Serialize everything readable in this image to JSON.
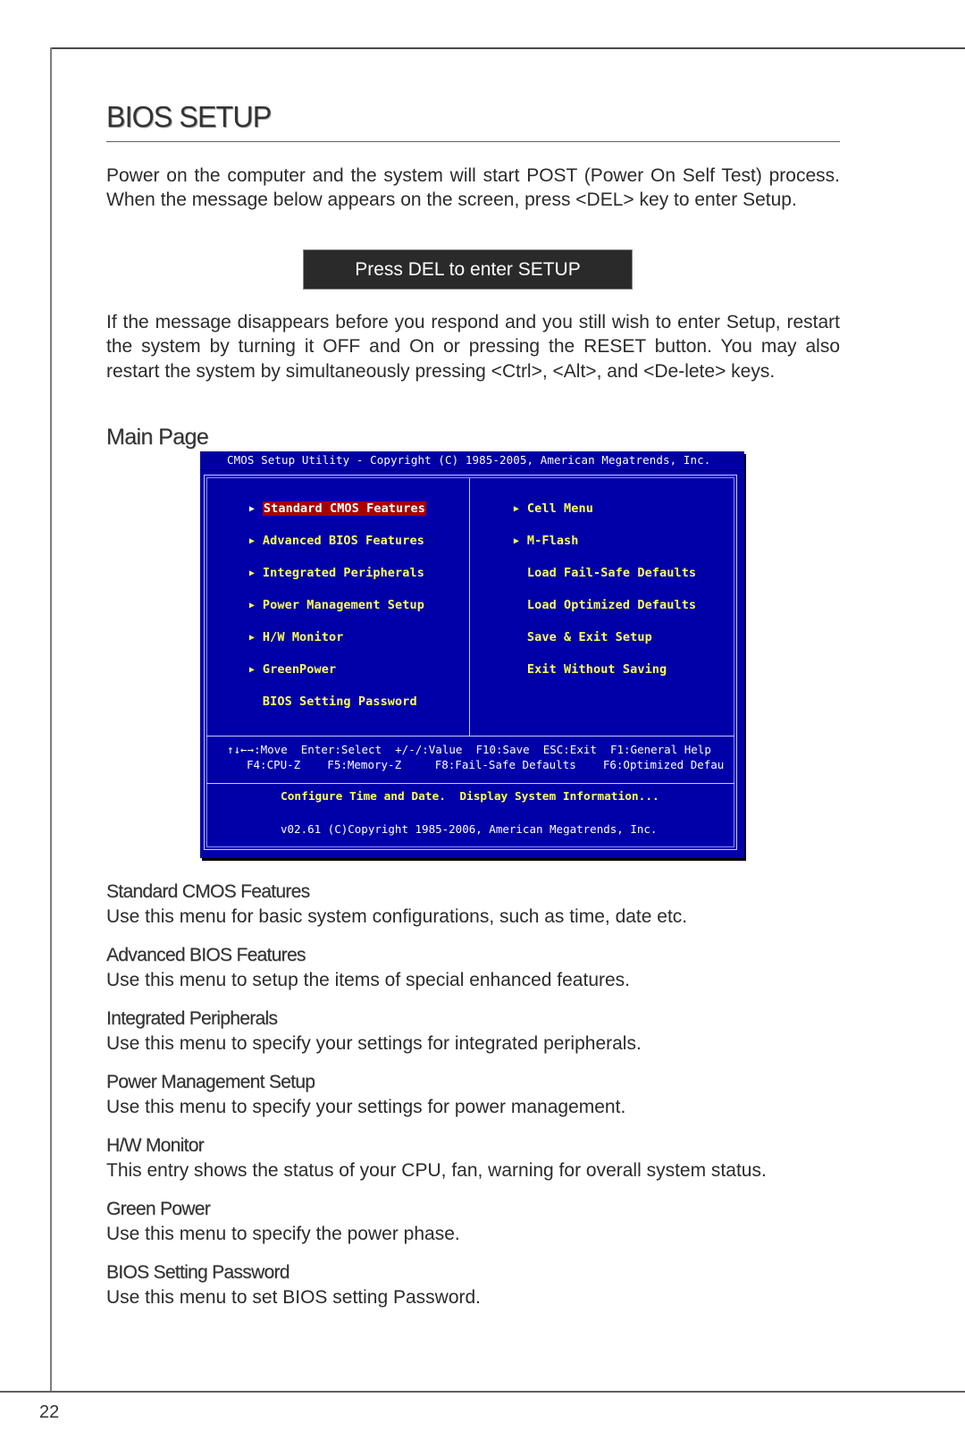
{
  "page": {
    "title": "BIOS SETUP",
    "page_number": "22"
  },
  "intro": {
    "paragraph1": "Power on the computer and the system will start POST (Power On Self Test) process. When the message below appears on the screen, press <DEL> key to enter Setup.",
    "del_message": "Press DEL to enter SETUP",
    "paragraph2": "If the message disappears before you respond and you still wish to enter Setup, restart the system by turning it OFF and On or pressing the RESET button. You may also restart the system by simultaneously pressing <Ctrl>, <Alt>, and <De-lete> keys."
  },
  "main_page": {
    "heading": "Main Page"
  },
  "bios_screen": {
    "colors": {
      "background": "#0000a8",
      "item_text": "#ffff55",
      "highlight": "#a80000",
      "help_text": "#ffffff"
    },
    "title_bar": "CMOS Setup Utility - Copyright (C) 1985-2005, American Megatrends, Inc.",
    "left_menu": [
      {
        "label": "Standard CMOS Features",
        "submenu": true,
        "selected": true
      },
      {
        "label": "Advanced BIOS Features",
        "submenu": true,
        "selected": false
      },
      {
        "label": "Integrated Peripherals",
        "submenu": true,
        "selected": false
      },
      {
        "label": "Power Management Setup",
        "submenu": true,
        "selected": false
      },
      {
        "label": "H/W Monitor",
        "submenu": true,
        "selected": false
      },
      {
        "label": "GreenPower",
        "submenu": true,
        "selected": false
      },
      {
        "label": "BIOS Setting Password",
        "submenu": false,
        "selected": false
      }
    ],
    "right_menu": [
      {
        "label": "Cell Menu",
        "submenu": true
      },
      {
        "label": "M-Flash",
        "submenu": true
      },
      {
        "label": "Load Fail-Safe Defaults",
        "submenu": false
      },
      {
        "label": "Load Optimized Defaults",
        "submenu": false
      },
      {
        "label": "Save & Exit Setup",
        "submenu": false
      },
      {
        "label": "Exit Without Saving",
        "submenu": false
      }
    ],
    "submenu_arrow": "▶",
    "help_line1": "↑↓←→:Move  Enter:Select  +/-/:Value  F10:Save  ESC:Exit  F1:General Help",
    "help_line2": "F4:CPU-Z    F5:Memory-Z     F8:Fail-Safe Defaults    F6:Optimized Defau",
    "item_description": "Configure Time and Date.  Display System Information...",
    "version_line": "v02.61 (C)Copyright 1985-2006, American Megatrends, Inc."
  },
  "descriptions": [
    {
      "heading": "Standard CMOS Features",
      "text": "Use this menu for basic system configurations, such as time, date etc."
    },
    {
      "heading": "Advanced BIOS Features",
      "text": "Use this menu to setup the items of special enhanced features."
    },
    {
      "heading": "Integrated Peripherals",
      "text": "Use this menu to specify your settings for integrated peripherals."
    },
    {
      "heading": "Power Management Setup",
      "text": "Use this menu to specify your settings for power management."
    },
    {
      "heading": "H/W Monitor",
      "text": "This entry shows the status of your CPU, fan, warning for overall system status."
    },
    {
      "heading": "Green Power",
      "text": "Use this menu to specify the power phase."
    },
    {
      "heading": "BIOS Setting Password",
      "text": "Use this menu to set BIOS setting Password."
    }
  ]
}
